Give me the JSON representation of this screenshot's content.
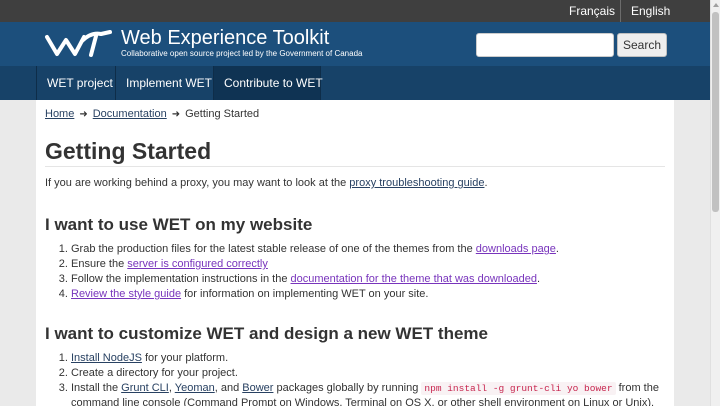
{
  "lang": {
    "fr": "Français",
    "en": "English"
  },
  "banner": {
    "title": "Web Experience Toolkit",
    "subtitle": "Collaborative open source project led by the Government of Canada",
    "search_placeholder": "",
    "search_button": "Search"
  },
  "menu": [
    "WET project",
    "Implement WET",
    "Contribute to WET"
  ],
  "breadcrumb": {
    "home": "Home",
    "docs": "Documentation",
    "current": "Getting Started"
  },
  "page_title": "Getting Started",
  "intro": {
    "before": "If you are working behind a proxy, you may want to look at the ",
    "link": "proxy troubleshooting guide",
    "after": "."
  },
  "section1": {
    "heading": "I want to use WET on my website",
    "items": [
      {
        "before": "Grab the production files for the latest stable release of one of the themes from the ",
        "link": "downloads page",
        "after": "."
      },
      {
        "before": "Ensure the ",
        "link": "server is configured correctly",
        "after": ""
      },
      {
        "before": "Follow the implementation instructions in the ",
        "link": "documentation for the theme that was downloaded",
        "after": "."
      },
      {
        "before": "",
        "link": "Review the style guide",
        "after": " for information on implementing WET on your site."
      }
    ]
  },
  "section2": {
    "heading": "I want to customize WET and design a new WET theme",
    "items": [
      {
        "link": "Install NodeJS",
        "after": " for your platform."
      },
      {
        "text": "Create a directory for your project."
      },
      {
        "before": "Install the ",
        "link1": "Grunt CLI",
        "sep1": ", ",
        "link2": "Yeoman",
        "sep2": ", and ",
        "link3": "Bower",
        "mid": " packages globally by running ",
        "code": "npm install -g grunt-cli yo bower",
        "after": " from the"
      },
      {
        "text": "command line console (Command Prompt on Windows, Terminal on OS X, or other shell environment on Linux or Unix)."
      }
    ]
  }
}
